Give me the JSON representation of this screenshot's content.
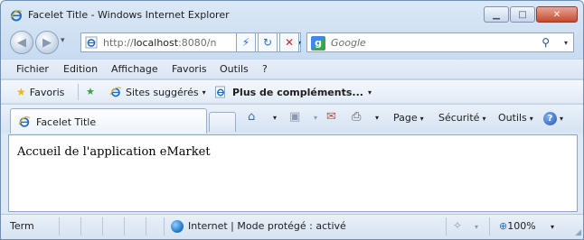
{
  "window": {
    "title": "Facelet Title - Windows Internet Explorer",
    "minimize_glyph": "▁",
    "maximize_glyph": "□",
    "close_glyph": "✕"
  },
  "navigation": {
    "back_glyph": "◀",
    "forward_glyph": "▶",
    "dropdown_glyph": "▾",
    "address_scheme": "http://",
    "address_host": "localhost",
    "address_rest": ":8080/n",
    "compat_glyph": "⚡",
    "refresh_glyph": "↻",
    "stop_glyph": "✕",
    "search_logo": "g",
    "search_placeholder": "Google",
    "search_go_glyph": "⚲",
    "search_dropdown_glyph": "▾"
  },
  "menu": {
    "items": [
      "Fichier",
      "Edition",
      "Affichage",
      "Favoris",
      "Outils",
      "?"
    ]
  },
  "favorites_bar": {
    "favorites_label": "Favoris",
    "favorites_icon": "★",
    "add_icon": "★",
    "suggested_label": "Sites suggérés",
    "more_label": "Plus de compléments...",
    "caret": "▾"
  },
  "tabs": {
    "active_label": "Facelet Title"
  },
  "command_bar": {
    "home_icon": "⌂",
    "feeds_icon": "▣",
    "mail_icon": "✉",
    "print_icon": "⎙",
    "page_label": "Page",
    "security_label": "Sécurité",
    "tools_label": "Outils",
    "help_icon": "?",
    "caret": "▾"
  },
  "content": {
    "text": "Accueil de l'application eMarket"
  },
  "status_bar": {
    "status_text": "Term",
    "zone_text": "Internet | Mode protégé : activé",
    "security_glyph": "✧",
    "zoom_label": "100%",
    "zoom_icon": "⊕",
    "dropdown_glyph": "▾",
    "resize_glyph": "◢"
  },
  "colors": {
    "frame": "#dbe8f6",
    "border": "#8ea6c4",
    "ie_blue": "#1c6fc4",
    "ie_gold": "#f1b31c"
  }
}
